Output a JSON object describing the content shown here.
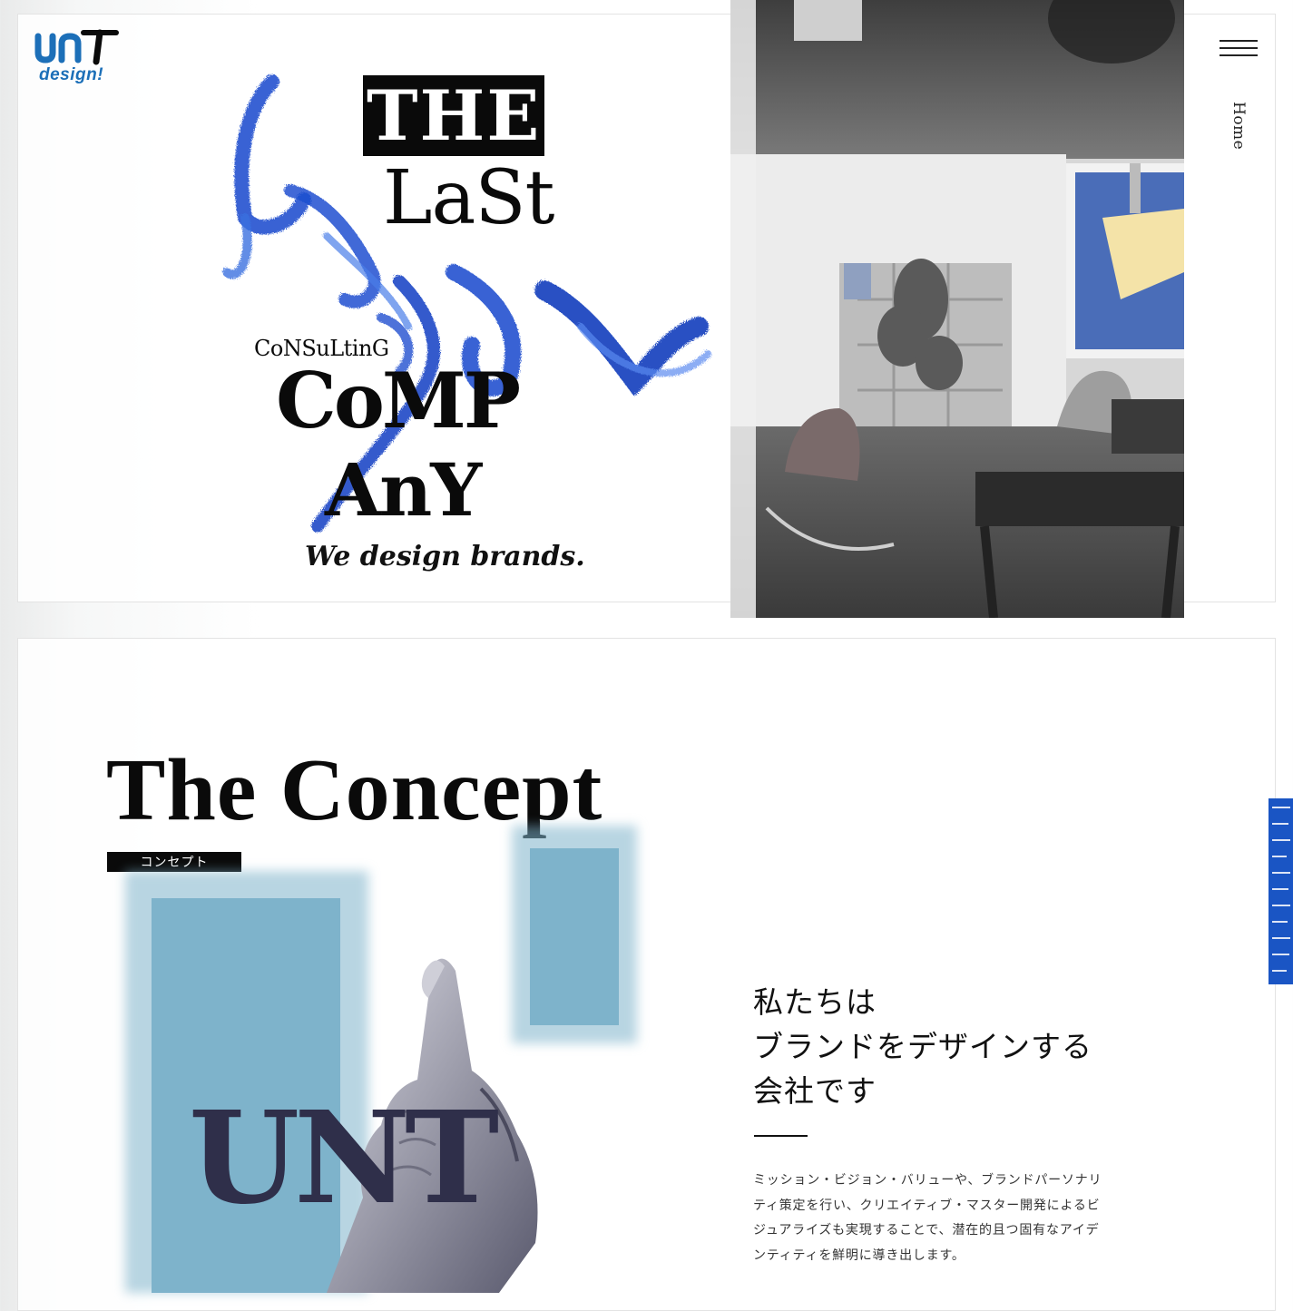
{
  "brand": {
    "logo_mark": "unT",
    "logo_sub": "design!",
    "brand_color": "#1c6fb8"
  },
  "nav": {
    "menu_icon": "hamburger-menu-icon",
    "current_page": "Home"
  },
  "hero": {
    "words": {
      "the": "THE",
      "last": "LaSt",
      "consulting": "CoNSuLtinG",
      "comp": "CoMP",
      "any": "AnY"
    },
    "tagline": "We design brands.",
    "accent_color": "#1f4fd0"
  },
  "concept": {
    "title": "The Concept",
    "badge": "コンセプト",
    "art_text": "UNT",
    "headline": [
      "私たちは",
      "ブランドをデザインする",
      "会社です"
    ],
    "body": [
      "ミッション・ビジョン・バリューや、ブランドパーソナリ",
      "ティ策定を行い、クリエイティブ・マスター開発によるビ",
      "ジュアライズも実現することで、潜在的且つ固有なアイデ",
      "ンティティを鮮明に導き出します。"
    ],
    "block_color": "#7eb3cb",
    "edge_color": "#1a55c4"
  }
}
